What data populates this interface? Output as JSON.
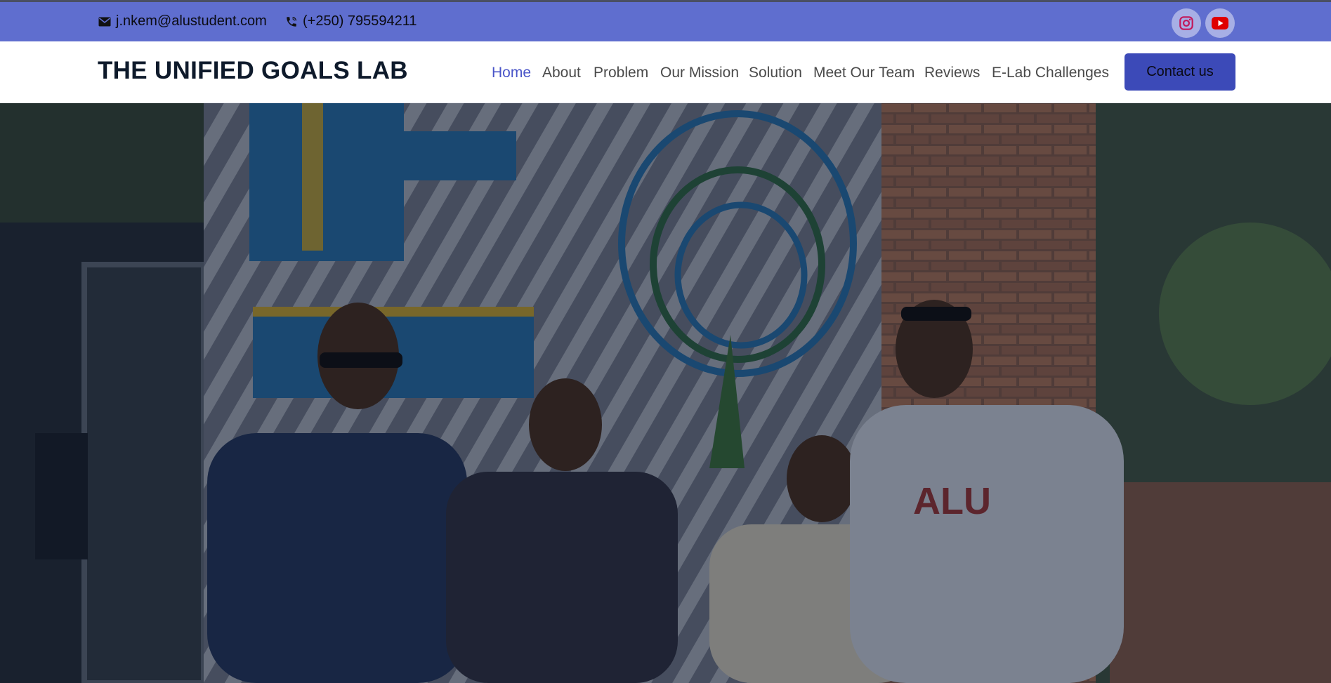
{
  "topbar": {
    "email": "j.nkem@alustudent.com",
    "phone": "(+250) 795594211",
    "email_icon": "envelope-icon",
    "phone_icon": "phone-icon",
    "social": [
      {
        "name": "instagram-icon"
      },
      {
        "name": "youtube-icon"
      }
    ]
  },
  "brand": "THE UNIFIED GOALS LAB",
  "nav": {
    "items": [
      {
        "label": "Home",
        "active": true
      },
      {
        "label": "About"
      },
      {
        "label": "Problem"
      },
      {
        "label": "Our Mission"
      },
      {
        "label": "Solution"
      },
      {
        "label": "Meet Our Team"
      },
      {
        "label": "Reviews"
      },
      {
        "label": "E-Lab Challenges"
      }
    ],
    "cta": "Contact us"
  },
  "hero": {
    "image_desc": "team-photo",
    "mural_letters": "ALU"
  },
  "colors": {
    "topbar": "#5f6ecf",
    "accent": "#4a55c8",
    "cta": "#3c4ab8",
    "brand_text": "#0e1a2b"
  }
}
